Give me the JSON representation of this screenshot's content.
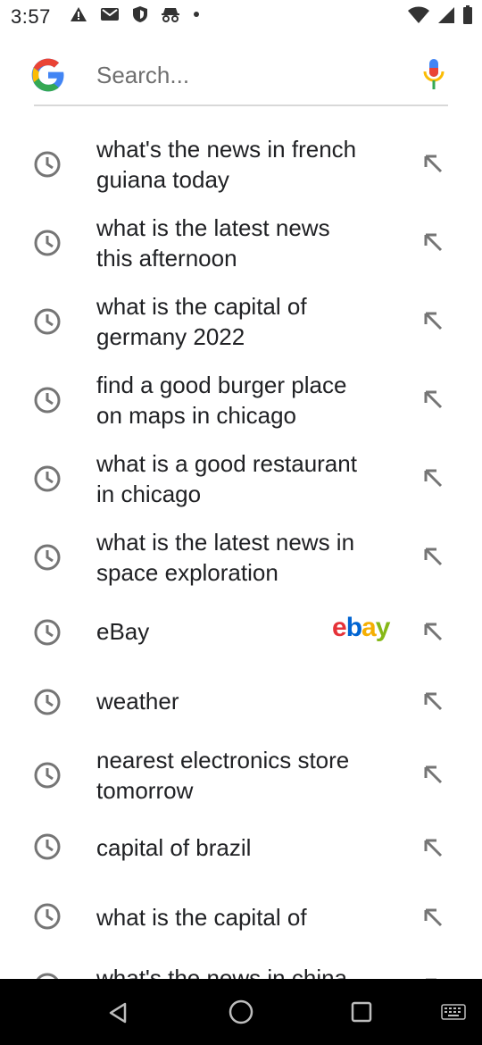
{
  "status_bar": {
    "time": "3:57"
  },
  "search": {
    "placeholder": "Search...",
    "value": ""
  },
  "suggestions": [
    {
      "line1": "what's the news in french",
      "line2": "guiana today"
    },
    {
      "line1": "what is the latest news",
      "line2": "this afternoon"
    },
    {
      "line1": "what is the capital of",
      "line2": "germany 2022"
    },
    {
      "line1": "find a good burger place",
      "line2": "on maps in chicago"
    },
    {
      "line1": "what is a good restaurant",
      "line2": "in chicago"
    },
    {
      "line1": "what is the latest news in",
      "line2": "space exploration"
    },
    {
      "line1": "eBay",
      "line2": ""
    },
    {
      "line1": "weather",
      "line2": ""
    },
    {
      "line1": "nearest electronics store",
      "line2": "tomorrow"
    },
    {
      "line1": "capital of brazil",
      "line2": ""
    },
    {
      "line1": "what is the capital of",
      "line2": ""
    },
    {
      "line1": "what's the news in china",
      "line2": ""
    }
  ],
  "ebay_logo": {
    "letters": [
      "e",
      "b",
      "a",
      "y"
    ],
    "colors": [
      "#e53238",
      "#0064d2",
      "#f5af02",
      "#86b817"
    ]
  },
  "colors": {
    "google_blue": "#4285F4",
    "google_red": "#EA4335",
    "google_yellow": "#FBBC05",
    "google_green": "#34A853",
    "icon_gray": "#757575"
  }
}
